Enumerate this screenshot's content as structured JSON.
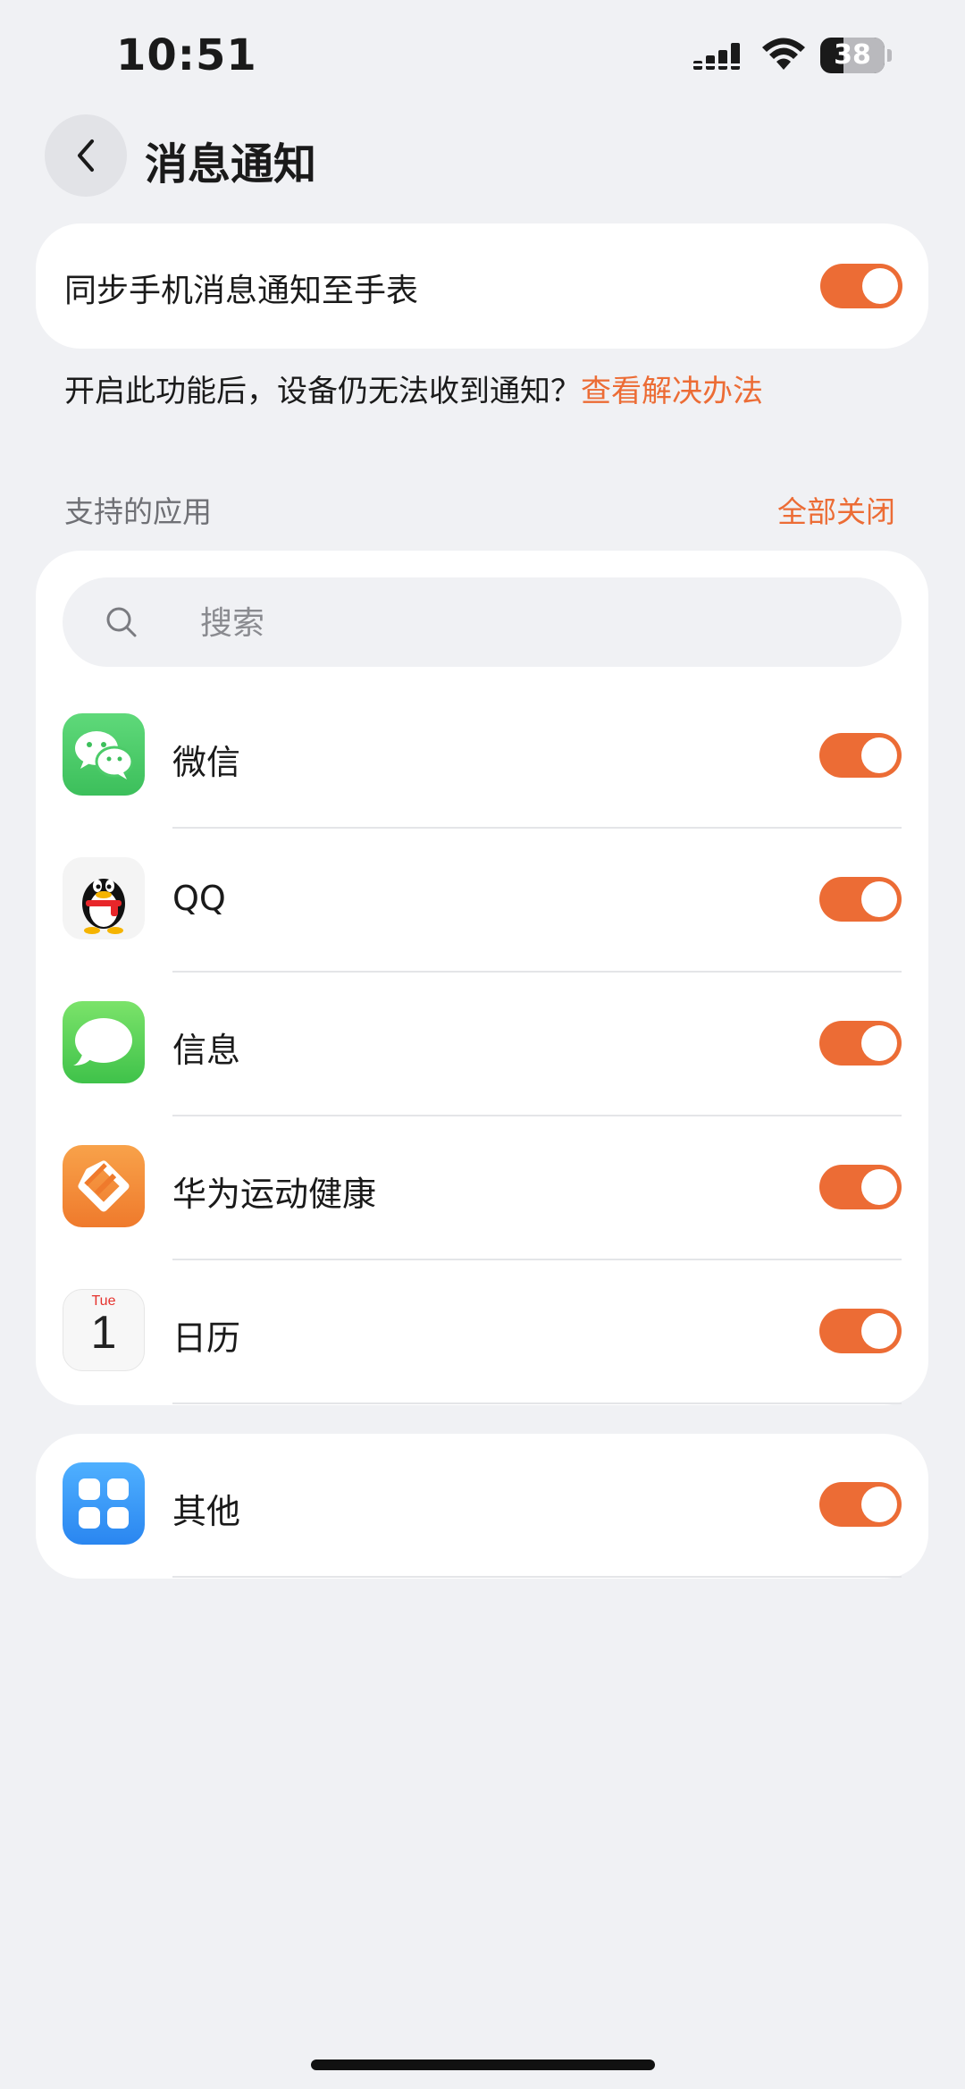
{
  "status_bar": {
    "time": "10:51",
    "battery": "38"
  },
  "header": {
    "title": "消息通知"
  },
  "sync": {
    "label": "同步手机消息通知至手表",
    "enabled": true
  },
  "help": {
    "text": "开启此功能后，设备仍无法收到通知？",
    "link": "查看解决办法"
  },
  "apps_section": {
    "title": "支持的应用",
    "close_all": "全部关闭"
  },
  "search": {
    "placeholder": "搜索"
  },
  "apps": [
    {
      "name": "微信",
      "icon": "wechat-icon",
      "enabled": true
    },
    {
      "name": "QQ",
      "icon": "qq-icon",
      "enabled": true
    },
    {
      "name": "信息",
      "icon": "messages-icon",
      "enabled": true
    },
    {
      "name": "华为运动健康",
      "icon": "huawei-health-icon",
      "enabled": true
    },
    {
      "name": "日历",
      "icon": "calendar-icon",
      "enabled": true,
      "icon_text": {
        "day": "Tue",
        "date": "1"
      }
    }
  ],
  "other": {
    "name": "其他",
    "icon": "other-apps-icon",
    "enabled": true
  },
  "colors": {
    "accent": "#ec6c35",
    "background": "#f0f1f4",
    "card": "#ffffff"
  }
}
